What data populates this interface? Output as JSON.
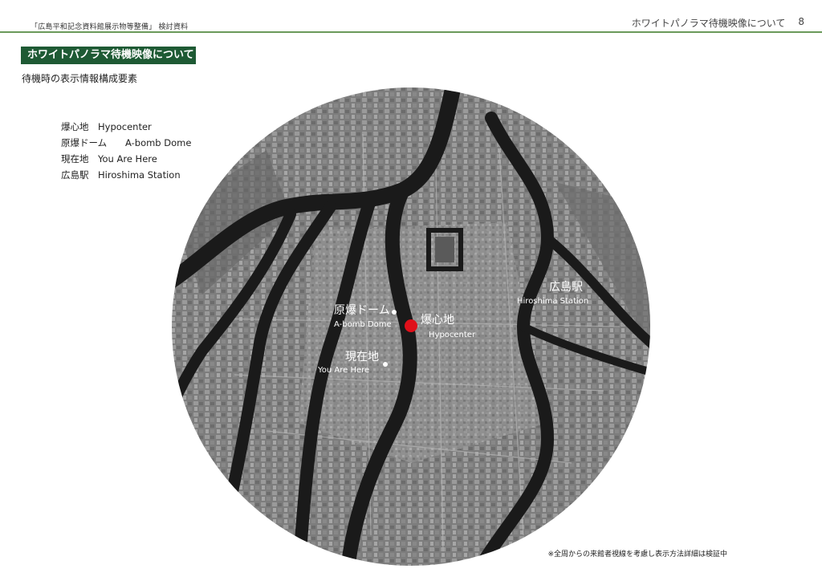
{
  "header": {
    "doc_title": "「広島平和記念資料館展示物等整備」 検討資料",
    "section_title": "ホワイトパノラマ待機映像について",
    "page_number": "8"
  },
  "section": {
    "heading": "ホワイトパノラマ待機映像について",
    "subtitle": "待機時の表示情報構成要素"
  },
  "legend": [
    {
      "jp": "爆心地",
      "en": "Hypocenter"
    },
    {
      "jp": "原爆ドーム",
      "en": "A-bomb Dome"
    },
    {
      "jp": "現在地",
      "en": "You Are Here"
    },
    {
      "jp": "広島駅",
      "en": "Hiroshima Station"
    }
  ],
  "map": {
    "colors": {
      "hypocenter_marker": "#e0101a",
      "river": "#1a1a1a",
      "land": "#8a8a8a"
    },
    "labels": {
      "station_jp": "広島駅",
      "station_en": "Hiroshima Station",
      "dome_jp": "原爆ドーム",
      "dome_en": "A-bomb Dome",
      "hypo_jp": "爆心地",
      "hypo_en": "Hypocenter",
      "here_jp": "現在地",
      "here_en": "You Are Here"
    }
  },
  "footnote": "※全周からの来館者視線を考慮し表示方法詳細は検証中"
}
